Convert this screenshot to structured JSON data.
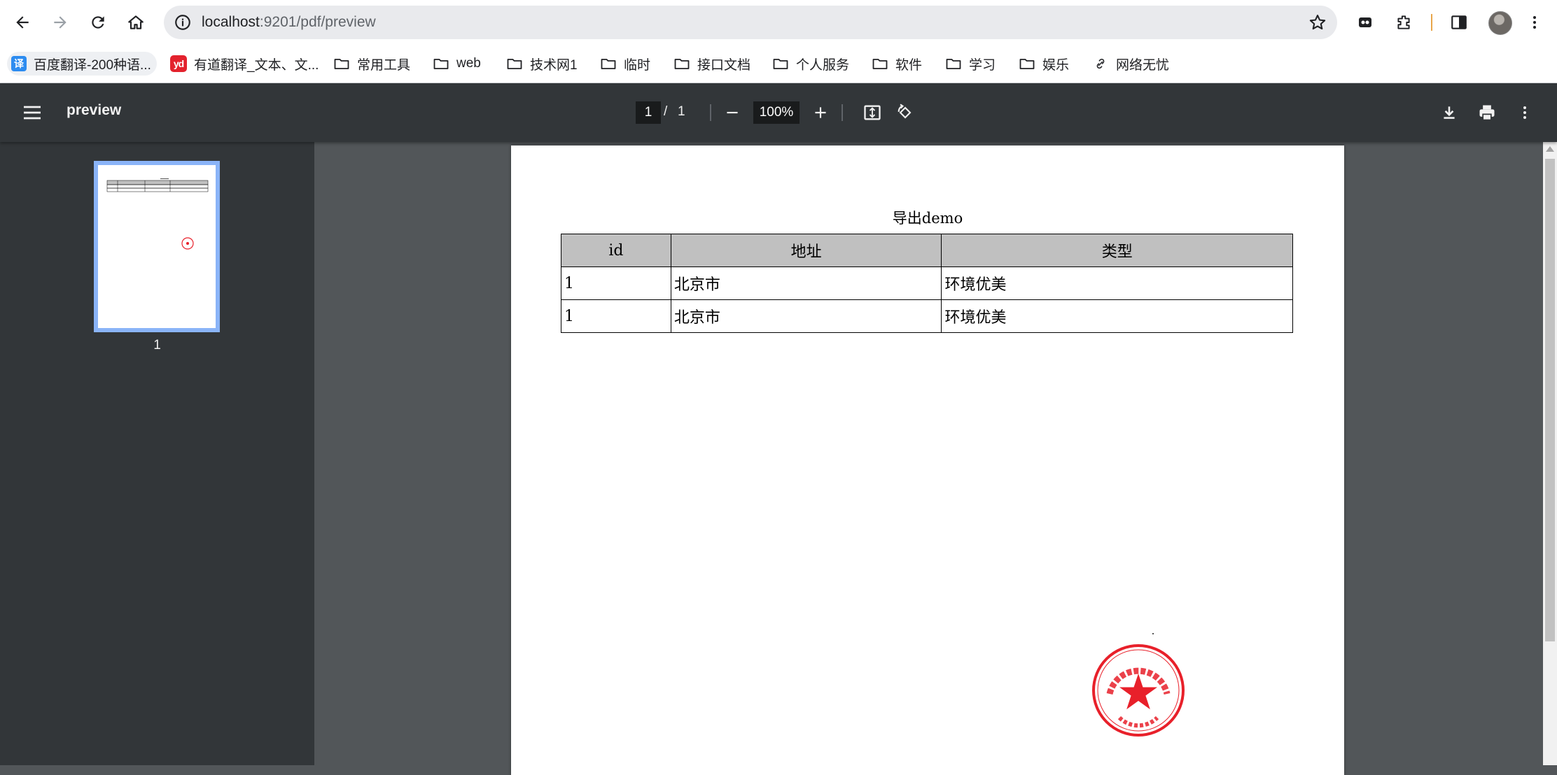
{
  "browser": {
    "url_host": "localhost",
    "url_path": ":9201/pdf/preview",
    "accent_color": "#8ab4f8"
  },
  "bookmarks": [
    {
      "label": "百度翻译-200种语...",
      "icon": "baidu-translate-icon",
      "icon_text": "译"
    },
    {
      "label": "有道翻译_文本、文...",
      "icon": "youdao-icon",
      "icon_text": "yd"
    },
    {
      "label": "常用工具",
      "icon": "folder-icon"
    },
    {
      "label": "web",
      "icon": "folder-icon"
    },
    {
      "label": "技术网1",
      "icon": "folder-icon"
    },
    {
      "label": "临时",
      "icon": "folder-icon"
    },
    {
      "label": "接口文档",
      "icon": "folder-icon"
    },
    {
      "label": "个人服务",
      "icon": "folder-icon"
    },
    {
      "label": "软件",
      "icon": "folder-icon"
    },
    {
      "label": "学习",
      "icon": "folder-icon"
    },
    {
      "label": "娱乐",
      "icon": "folder-icon"
    },
    {
      "label": "网络无忧",
      "icon": "link-icon"
    }
  ],
  "pdf": {
    "title": "preview",
    "current_page": "1",
    "page_separator": "/",
    "total_pages": "1",
    "zoom": "100%",
    "thumbnail_label": "1"
  },
  "document": {
    "title": "导出demo",
    "columns": [
      "id",
      "地址",
      "类型"
    ],
    "rows": [
      [
        "1",
        "北京市",
        "环境优美"
      ],
      [
        "1",
        "北京市",
        "环境优美"
      ]
    ],
    "stamp_color": "#e8202a"
  }
}
